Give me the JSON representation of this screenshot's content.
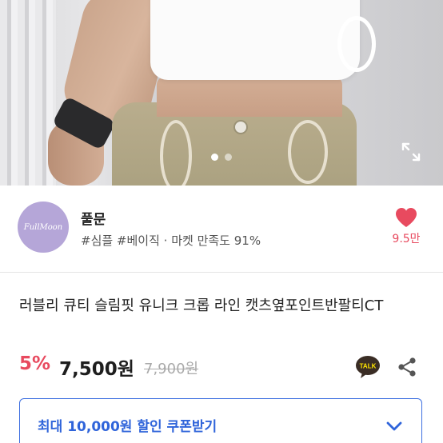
{
  "gallery": {
    "page_count": 2,
    "active_index": 0
  },
  "shop": {
    "name": "풀문",
    "logo_text": "FullMoon",
    "meta": "#심플 #베이직 · 마켓 만족도 91%",
    "like_count": "9.5만"
  },
  "product": {
    "title": "러블리 큐티 슬림핏 유니크 크롭 라인 캣츠옆포인트반팔티CT",
    "discount": "5%",
    "price": "7,500원",
    "original_price": "7,900원"
  },
  "talk_icon_text": "TALK",
  "coupon": {
    "label": "최대 10,000원 할인 쿠폰받기"
  },
  "colors": {
    "accent_red": "#e84a5f",
    "coupon_blue": "#2f64da",
    "logo_purple": "#b5a6d8",
    "talk_yellow": "#fee500"
  },
  "icons": {
    "expand": "expand-icon",
    "like": "heart-icon",
    "talk": "kakaotalk-icon",
    "share": "share-icon",
    "coupon_toggle": "chevron-down-icon"
  }
}
